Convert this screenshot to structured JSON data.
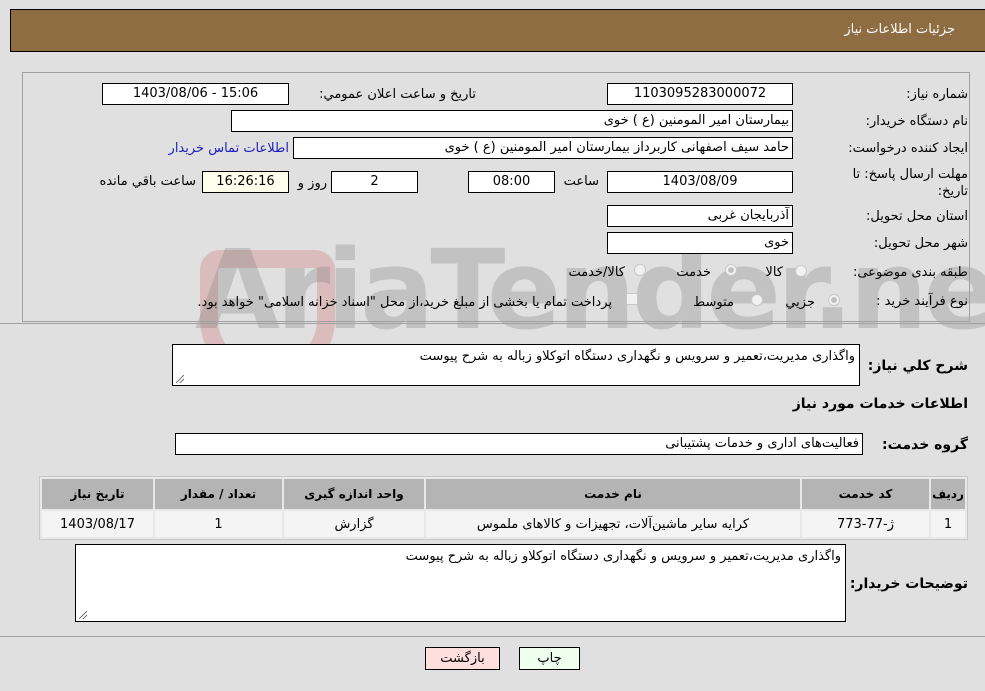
{
  "header": {
    "title": "جزئیات اطلاعات نیاز"
  },
  "form": {
    "need_number": {
      "label": "شماره نیاز:",
      "value": "1103095283000072"
    },
    "announce_datetime": {
      "label": "تاریخ و ساعت اعلان عمومي:",
      "value": "1403/08/06 - 15:06"
    },
    "buyer_org": {
      "label": "نام دستگاه خريدار:",
      "value": "بیمارستان امیر المومنین (ع ) خوی"
    },
    "requester": {
      "label": "ايجاد کننده درخواست:",
      "value": "حامد سیف اصفهانی کاربرداز بیمارستان امیر المومنین (ع ) خوی"
    },
    "buyer_contact_link": "اطلاعات تماس خريدار",
    "deadline": {
      "label": "مهلت ارسال پاسخ: تا تاریخ:",
      "date": "1403/08/09",
      "time_label": "ساعت",
      "time": "08:00",
      "days": "2",
      "days_label": "روز و",
      "remaining": "16:26:16",
      "remaining_label": "ساعت باقي مانده"
    },
    "province": {
      "label": "استان محل تحویل:",
      "value": "آذربایجان غربی"
    },
    "city": {
      "label": "شهر محل تحویل:",
      "value": "خوی"
    },
    "category": {
      "label": "طبقه بندی موضوعی:",
      "options": [
        "کالا",
        "خدمت",
        "کالا/خدمت"
      ],
      "selected": "خدمت"
    },
    "purchase_type": {
      "label": "نوع فرآیند خرید :",
      "options": [
        "جزيي",
        "متوسط"
      ],
      "selected": "جزيي",
      "treasury_note": "پرداخت تمام یا بخشی از مبلغ خرید،از محل \"اسناد خزانه اسلامی\" خواهد بود."
    }
  },
  "description": {
    "label": "شرح کلي نياز:",
    "value": "واگذاری مدیریت،تعمیر و سرویس و نگهداری دستگاه اتوکلاو زباله به شرح پیوست"
  },
  "services_section": {
    "title": "اطلاعات خدمات مورد نیاز",
    "group_label": "گروه خدمت:",
    "group_value": "فعالیت‌های اداری و خدمات پشتیبانی",
    "table": {
      "headers": [
        "رديف",
        "کد خدمت",
        "نام خدمت",
        "واحد اندازه گیری",
        "تعداد / مقدار",
        "تاریخ نیاز"
      ],
      "rows": [
        [
          "1",
          "ژ-77-773",
          "کرایه سایر ماشین‌آلات، تجهیزات و کالاهای ملموس",
          "گزارش",
          "1",
          "1403/08/17"
        ]
      ]
    }
  },
  "buyer_notes": {
    "label": "توضیحات خریدار:",
    "value": "واگذاری مدیریت،تعمیر و سرویس و نگهداری دستگاه اتوکلاو زباله به شرح پیوست"
  },
  "buttons": {
    "print": "چاپ",
    "back": "بازگشت"
  },
  "colors": {
    "header": "#8e6d42",
    "print_bg": "#eeffee",
    "back_bg": "#ffdede",
    "link": "#2020c0"
  }
}
